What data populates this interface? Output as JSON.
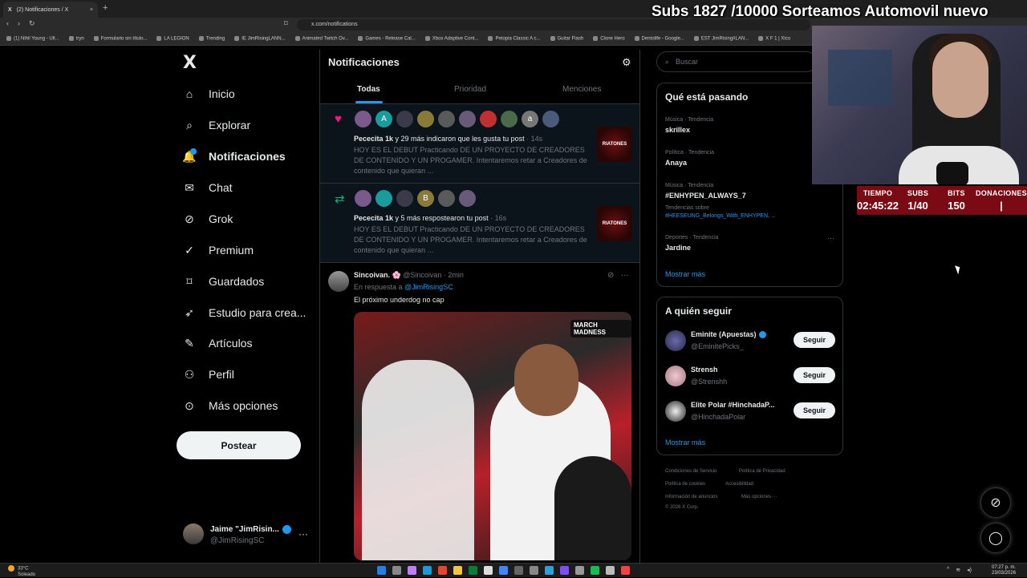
{
  "browser": {
    "tab_title": "(2) Notificaciones / X",
    "tab_close": "×",
    "new_tab": "+",
    "url": "x.com/notifications",
    "bookmarks": [
      "(1) Nihil Young - Ult...",
      "tryn",
      "Formulario sin título...",
      "LA LEGION",
      "Trending",
      "IE JimRisingLANN...",
      "Animated Twitch Ov...",
      "Games - Release Cal...",
      "Xbox Adaptive Cont...",
      "Petopia Classic A c...",
      "Guitar Flash",
      "Clone Hero",
      "Dentolife - Google...",
      "EST JimRising#LAN...",
      "X F 1 | Xico"
    ]
  },
  "stream": {
    "banner": "Subs 1827 /10000 Sorteamos Automovil nuevo",
    "stats": [
      {
        "header": "TIEMPO",
        "value": "02:45:22"
      },
      {
        "header": "SUBS",
        "value": "1/40"
      },
      {
        "header": "BITS",
        "value": "150"
      },
      {
        "header": "DONACIONES",
        "value": "|"
      }
    ]
  },
  "sidebar": {
    "logo": "X",
    "items": [
      {
        "label": "Inicio",
        "icon": "home-icon"
      },
      {
        "label": "Explorar",
        "icon": "search-icon"
      },
      {
        "label": "Notificaciones",
        "icon": "bell-icon"
      },
      {
        "label": "Chat",
        "icon": "mail-icon"
      },
      {
        "label": "Grok",
        "icon": "grok-icon"
      },
      {
        "label": "Premium",
        "icon": "verified-icon"
      },
      {
        "label": "Guardados",
        "icon": "bookmark-icon"
      },
      {
        "label": "Estudio para crea...",
        "icon": "rocket-icon"
      },
      {
        "label": "Artículos",
        "icon": "article-icon"
      },
      {
        "label": "Perfil",
        "icon": "person-icon"
      },
      {
        "label": "Más opciones",
        "icon": "more-circle-icon"
      }
    ],
    "post_button": "Postear",
    "profile": {
      "name": "Jaime \"JimRisin...",
      "handle": "@JimRisingSC",
      "more": "···"
    }
  },
  "main": {
    "title": "Notificaciones",
    "tabs": [
      "Todas",
      "Prioridad",
      "Menciones"
    ],
    "notifications": [
      {
        "type": "like",
        "actor": "Pececita 1k",
        "text": " y 29 más indicaron que les gusta tu post",
        "time": "· 14s",
        "body": "HOY ES EL DEBUT Practicando DE UN PROYECTO DE CREADORES DE CONTENIDO Y UN PROGAMER. Intentaremos retar a Creadores de contenido que quieran ...",
        "avatar_letters": [
          "",
          "A",
          "",
          "",
          "",
          "",
          "",
          "",
          "a",
          ""
        ],
        "thumb_label": "RIATONES"
      },
      {
        "type": "repost",
        "actor": "Pececita 1k",
        "text": " y 5 más respostearon tu post",
        "time": "· 16s",
        "body": "HOY ES EL DEBUT Practicando DE UN PROYECTO DE CREADORES DE CONTENIDO Y UN PROGAMER. Intentaremos retar a Creadores de contenido que quieran ...",
        "avatar_letters": [
          "",
          "",
          "",
          "B",
          "",
          ""
        ],
        "thumb_label": "RIATONES"
      }
    ],
    "tweet": {
      "name": "Sincoivan. 🌸",
      "handle": "@Sincoivan · 2min",
      "reply_prefix": "En respuesta a ",
      "reply_to": "@JimRisingSC",
      "text": "El próximo underdog no cap",
      "media_badge": "MARCH MADNESS"
    }
  },
  "right": {
    "search_placeholder": "Buscar",
    "trends_title": "Qué está pasando",
    "trends": [
      {
        "category": "Música · Tendencia",
        "name": "skrillex"
      },
      {
        "category": "Política · Tendencia",
        "name": "Anaya"
      },
      {
        "category": "Música · Tendencia",
        "name": "#ENHYPEN_ALWAYS_7",
        "sub": "Tendencias sobre",
        "link": "#HEESEUNG_Belongs_With_ENHYPEN, ..."
      },
      {
        "category": "Deportes · Tendencia",
        "name": "Jardine"
      }
    ],
    "trends_more": "Mostrar más",
    "follow_title": "A quién seguir",
    "follow": [
      {
        "name": "Eminite (Apuestas)",
        "handle": "@EminitePicks_",
        "button": "Seguir",
        "verified": true
      },
      {
        "name": "Strensh",
        "handle": "@Strenshh",
        "button": "Seguir",
        "verified": false
      },
      {
        "name": "Elite Polar #HinchadaP...",
        "handle": "@HinchadaPolar",
        "button": "Seguir",
        "verified": false
      }
    ],
    "follow_more": "Mostrar más",
    "footer": {
      "terms": "Condiciones de Servicio",
      "privacy": "Política de Privacidad",
      "cookies": "Política de cookies",
      "accessibility": "Accesibilidad",
      "ads": "Información de anuncios",
      "more": "Más opciones ···",
      "copyright": "© 2026 X Corp."
    }
  },
  "taskbar": {
    "temp": "33°C",
    "weather": "Soleado",
    "time": "07:27 p. m.",
    "date": "23/03/2026"
  },
  "colors": {
    "accent": "#1d9bf0",
    "like": "#f91880",
    "repost": "#00ba7c",
    "stats_bg": "#7a0a14"
  }
}
